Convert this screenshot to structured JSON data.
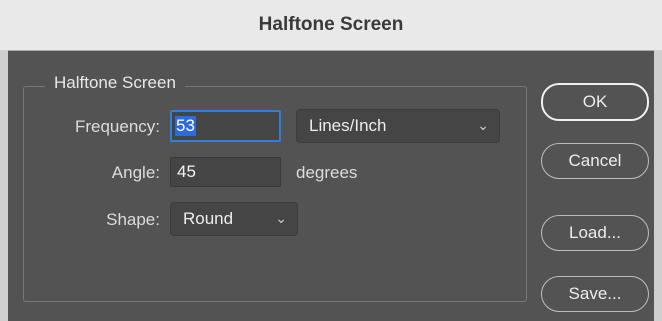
{
  "window": {
    "title": "Halftone Screen"
  },
  "group": {
    "title": "Halftone Screen"
  },
  "frequency": {
    "label": "Frequency:",
    "value": "53",
    "unit_selected": "Lines/Inch"
  },
  "angle": {
    "label": "Angle:",
    "value": "45",
    "unit": "degrees"
  },
  "shape": {
    "label": "Shape:",
    "selected": "Round"
  },
  "buttons": {
    "ok": "OK",
    "cancel": "Cancel",
    "load": "Load...",
    "save": "Save..."
  },
  "colors": {
    "accent": "#2f6ad8",
    "background": "#535353",
    "titlebar": "#e9e9e9"
  }
}
